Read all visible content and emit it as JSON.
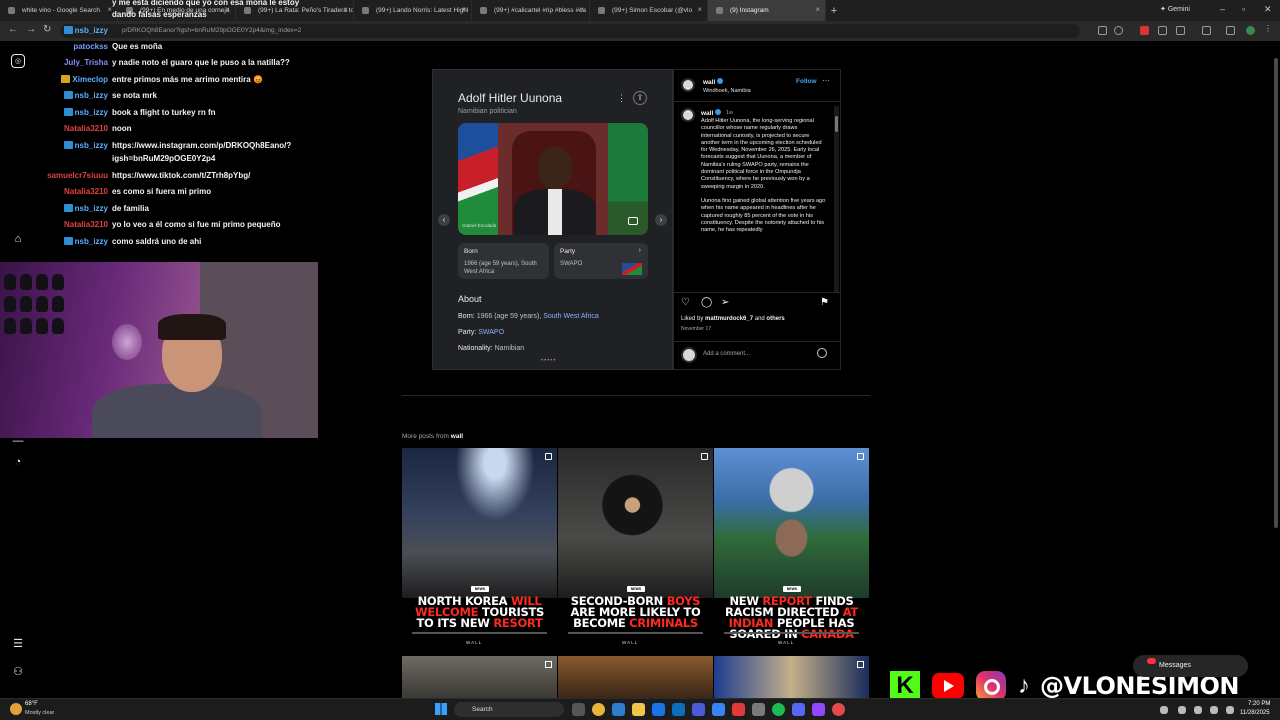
{
  "browser": {
    "tabs": [
      {
        "label": "white vino - Google Search",
        "active": false
      },
      {
        "label": "(99+) En medio de una corneja",
        "active": false
      },
      {
        "label": "(99+) La Rata: Peño's Tiradera to",
        "active": false
      },
      {
        "label": "(99+) Lando Norris: Latest Highl",
        "active": false
      },
      {
        "label": "(99+) #calicartel #rip #bless #ca",
        "active": false
      },
      {
        "label": "(99+) Simon Escobar (@vlo",
        "active": false
      },
      {
        "label": "(9) Instagram",
        "active": true
      }
    ],
    "gemini_label": "Gemini",
    "url": "p/DRKOQh8Eano/?igsh=bnRuM29pOGE0Y2p4&img_index=2"
  },
  "chat": [
    {
      "user": "",
      "message": "y me está diciendo que yo con esa mona le estoy",
      "user_color": "#e04040"
    },
    {
      "user": "",
      "message": "dando falsas esperanzas",
      "user_color": "#e04040"
    },
    {
      "user": "nsb_izzy",
      "message": "",
      "user_color": "#5ab0ff",
      "badge": true
    },
    {
      "user": "patockss",
      "message": "Que es moña",
      "user_color": "#7a9cff"
    },
    {
      "user": "July_Trisha",
      "message": "y nadie noto el guaro que le puso a la natilla??",
      "user_color": "#8a8aff"
    },
    {
      "user": "Ximeclop",
      "message": "entre primos más me arrimo mentira 😡",
      "user_color": "#5ab0ff",
      "badge": true,
      "gold": true
    },
    {
      "user": "nsb_izzy",
      "message": "se nota mrk",
      "user_color": "#5ab0ff",
      "badge": true
    },
    {
      "user": "nsb_izzy",
      "message": "book a flight to turkey rn fn",
      "user_color": "#5ab0ff",
      "badge": true
    },
    {
      "user": "Natalia3210",
      "message": "noon",
      "user_color": "#e04040"
    },
    {
      "user": "nsb_izzy",
      "message": "https://www.instagram.com/p/DRKOQh8Eano/?",
      "user_color": "#5ab0ff",
      "badge": true
    },
    {
      "user": "",
      "message": "igsh=bnRuM29pOGE0Y2p4",
      "user_color": "#5ab0ff"
    },
    {
      "user": "samuelcr7siuuu",
      "message": "https://www.tiktok.com/t/ZTrh8pYbg/",
      "user_color": "#e04040"
    },
    {
      "user": "Natalia3210",
      "message": "es como si fuera mi primo",
      "user_color": "#e04040"
    },
    {
      "user": "nsb_izzy",
      "message": "de familia",
      "user_color": "#5ab0ff",
      "badge": true
    },
    {
      "user": "Natalia3210",
      "message": "yo lo veo a él como si fue mi primo pequeño",
      "user_color": "#e04040"
    },
    {
      "user": "nsb_izzy",
      "message": "como saldrá uno de ahi",
      "user_color": "#5ab0ff",
      "badge": true
    }
  ],
  "knowledge_panel": {
    "title": "Adolf Hitler Uunona",
    "subtitle": "Namibian politician",
    "photo_credit": "Gabriel Escalada",
    "born_label": "Born",
    "born_value": "1966 (age 59 years), South West Africa",
    "party_label": "Party",
    "party_value": "SWAPO",
    "about_heading": "About",
    "facts": [
      {
        "label": "Born:",
        "value": "1966 (age 59 years),",
        "link": "South West Africa"
      },
      {
        "label": "Party:",
        "value": "",
        "link": "SWAPO"
      },
      {
        "label": "Nationality:",
        "value": "Namibian",
        "link": ""
      }
    ],
    "dots": "•••••"
  },
  "instagram": {
    "username": "wall",
    "location": "Windhoek, Namibia",
    "follow_label": "Follow",
    "time": "1w",
    "caption": [
      "Adolf Hitler Uunona, the long-serving regional councillor whose name regularly draws international curiosity, is projected to secure another term in the upcoming election scheduled for Wednesday, November 26, 2025. Early local forecasts suggest that Uunona, a member of Namibia's ruling SWAPO party, remains the dominant political force in the Ompundja Constituency, where he previously won by a sweeping margin in 2020.",
      "Uunona first gained global attention five years ago when his name appeared in headlines after he captured roughly 85 percent of the vote in his constituency. Despite the notoriety attached to his name, he has repeatedly"
    ],
    "liked_by_prefix": "Liked by",
    "liked_by_user": "mattmurdock6_7",
    "liked_by_suffix": "and",
    "liked_by_others": "others",
    "date": "November 17",
    "comment_placeholder": "Add a comment...",
    "more_posts_prefix": "More posts from",
    "more_posts_user": "wall"
  },
  "posts": [
    {
      "badge": "NEWS",
      "headline_parts": [
        {
          "t": "NORTH KOREA ",
          "hl": false
        },
        {
          "t": "WILL",
          "hl": true
        },
        {
          "t": " WELCOME ",
          "hl": true
        },
        {
          "t": "TOURISTS TO ITS NEW ",
          "hl": false
        },
        {
          "t": "RESORT",
          "hl": true
        }
      ],
      "brand": "WALL"
    },
    {
      "badge": "NEWS",
      "headline_parts": [
        {
          "t": "SECOND-BORN ",
          "hl": false
        },
        {
          "t": "BOYS",
          "hl": true
        },
        {
          "t": " ARE MORE LIKELY TO BECOME ",
          "hl": false
        },
        {
          "t": "CRIMINALS",
          "hl": true
        }
      ],
      "brand": "WALL"
    },
    {
      "badge": "NEWS",
      "headline_parts": [
        {
          "t": "NEW ",
          "hl": false
        },
        {
          "t": "REPORT",
          "hl": true
        },
        {
          "t": " FINDS RACISM DIRECTED ",
          "hl": false
        },
        {
          "t": "AT INDIAN",
          "hl": true
        },
        {
          "t": " PEOPLE HAS SOARED IN ",
          "hl": false
        },
        {
          "t": "CANADA",
          "hl": true
        }
      ],
      "brand": "WALL"
    }
  ],
  "overlay": {
    "kick_letter": "K",
    "handle": "@VLONESIMON",
    "messages_label": "Messages"
  },
  "taskbar": {
    "weather_temp": "68°F",
    "weather_status": "Mostly clear",
    "search_label": "Search",
    "time": "7:20 PM",
    "date": "11/28/2025"
  }
}
